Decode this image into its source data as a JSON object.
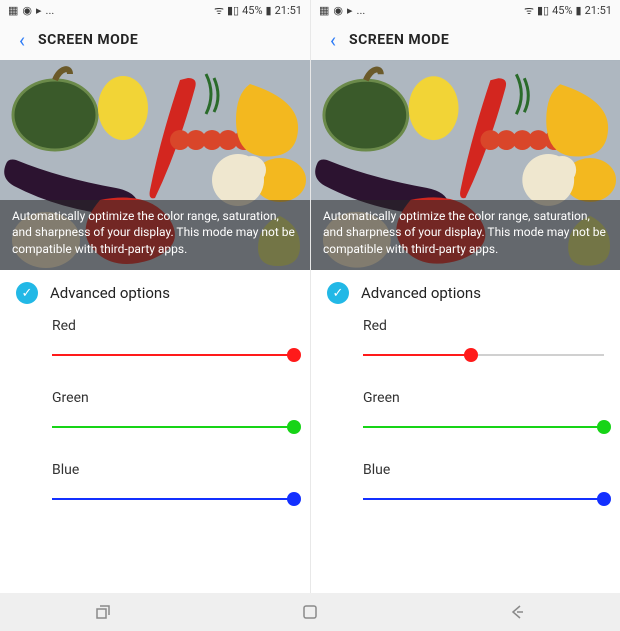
{
  "status": {
    "left_icons": [
      "image-icon",
      "globe-icon",
      "play-icon",
      "ellipsis"
    ],
    "signal_icon": "signal-icon",
    "wifi_icon": "wifi-icon",
    "battery_pct": "45%",
    "battery_icon": "battery-icon",
    "time": "21:51"
  },
  "topbar": {
    "back_glyph": "‹",
    "title": "SCREEN MODE"
  },
  "preview": {
    "description": "Automatically optimize the color range, saturation, and sharpness of your display. This mode may not be compatible with third-party apps."
  },
  "advanced": {
    "check_glyph": "✓",
    "label": "Advanced options"
  },
  "sliders_left": [
    {
      "label": "Red",
      "value": 100,
      "color": "#ff1a1a"
    },
    {
      "label": "Green",
      "value": 100,
      "color": "#17d417"
    },
    {
      "label": "Blue",
      "value": 100,
      "color": "#1330ff"
    }
  ],
  "sliders_right": [
    {
      "label": "Red",
      "value": 45,
      "color": "#ff1a1a"
    },
    {
      "label": "Green",
      "value": 100,
      "color": "#17d417"
    },
    {
      "label": "Blue",
      "value": 100,
      "color": "#1330ff"
    }
  ],
  "nav": {
    "recents": "recents-icon",
    "home": "home-icon",
    "back": "back-icon"
  }
}
